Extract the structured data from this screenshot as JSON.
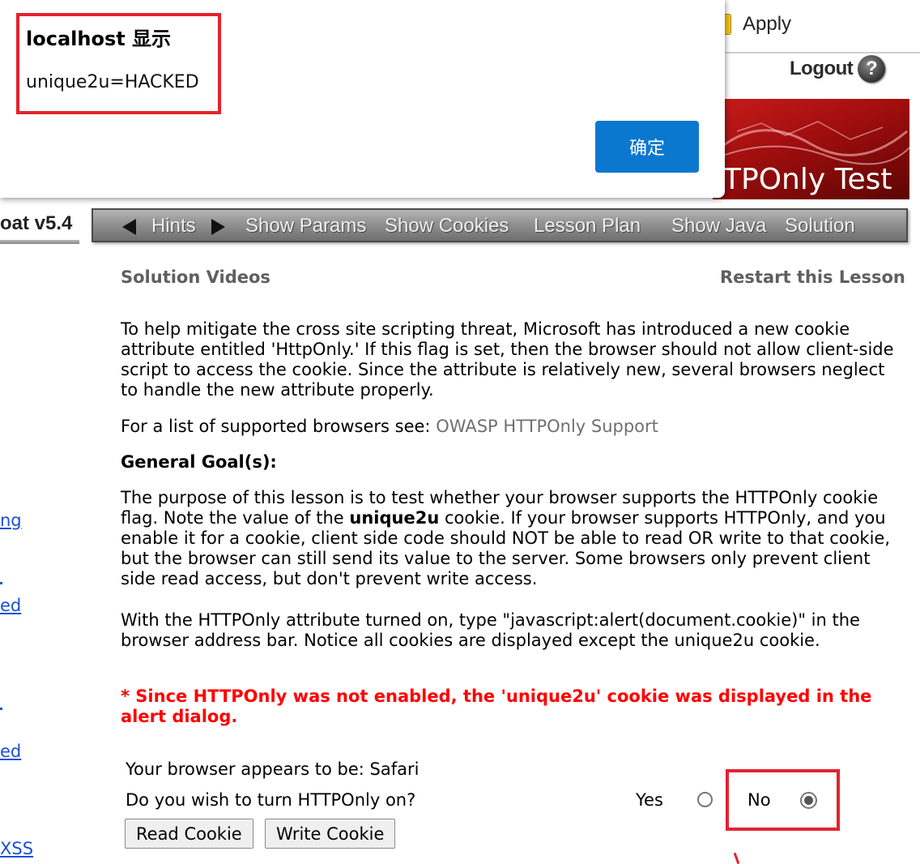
{
  "top": {
    "apply_label": "Apply",
    "logout_label": "Logout",
    "help_glyph": "?"
  },
  "banner": {
    "title": "TPOnly Test"
  },
  "nav": {
    "brand": "oat  v5.4",
    "items": [
      "Hints",
      "Show Params",
      "Show Cookies",
      "Lesson Plan",
      "Show Java",
      "Solution"
    ]
  },
  "content": {
    "solution_videos": "Solution Videos",
    "restart": "Restart this Lesson",
    "p1": "To help mitigate the cross site scripting threat, Microsoft has introduced a new cookie attribute entitled 'HttpOnly.' If this flag is set, then the browser should not allow client-side script to access the cookie. Since the attribute is relatively new, several browsers neglect to handle the new attribute properly.",
    "p2_prefix": "For a list of supported browsers see: ",
    "p2_link": "OWASP HTTPOnly Support",
    "goal_heading": "General Goal(s):",
    "p3_a": "The purpose of this lesson is to test whether your browser supports the HTTPOnly cookie flag. Note the value of the ",
    "p3_bold": "unique2u",
    "p3_b": " cookie. If your browser supports HTTPOnly, and you enable it for a cookie, client side code should NOT be able to read OR write to that cookie, but the browser can still send its value to the server. Some browsers only prevent client side read access, but don't prevent write access.",
    "p4": "With the HTTPOnly attribute turned on, type \"javascript:alert(document.cookie)\" in the browser address bar. Notice all cookies are displayed except the unique2u cookie.",
    "warning": "* Since HTTPOnly was not enabled, the 'unique2u' cookie was displayed in the alert dialog.",
    "browser_line": "Your browser appears to be: Safari",
    "question": "Do you wish to turn HTTPOnly on?",
    "yes_label": "Yes",
    "no_label": "No",
    "selected": "No",
    "read_cookie": "Read Cookie",
    "write_cookie": "Write Cookie"
  },
  "sidebar": {
    "fragments": [
      "ng",
      "ed",
      "ed",
      "XSS"
    ]
  },
  "dialog": {
    "title": "localhost 显示",
    "message": "unique2u=HACKED",
    "ok_label": "确定"
  },
  "colors": {
    "warning": "#ff0000",
    "annotation": "#e3232f",
    "ok_button": "#0b78d0",
    "link_sidebar": "#1a4fd6"
  }
}
